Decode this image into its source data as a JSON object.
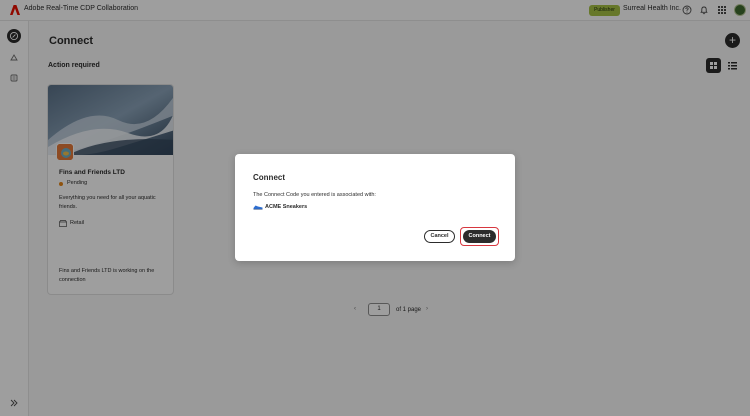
{
  "app": {
    "title": "Adobe Real-Time CDP Collaboration",
    "role_badge": "Publisher",
    "org_name": "Surreal Health Inc.",
    "brand_color": "#eb1000"
  },
  "icons": {
    "logo": "adobe-logo-icon",
    "help": "help-icon",
    "notifications": "bell-icon",
    "apps": "apps-grid-icon",
    "rail": [
      "connect-icon",
      "collaborations-icon",
      "audiences-icon"
    ],
    "rail_expand": "chevron-double-right-icon"
  },
  "page": {
    "title": "Connect",
    "add_label": "+",
    "section_title": "Action required"
  },
  "card": {
    "title": "Fins and Friends LTD",
    "status": "Pending",
    "status_color": "#e68619",
    "description": "Everything you need for all your aquatic friends.",
    "industry": "Retail",
    "footer": "Fins and Friends LTD is working on the connection"
  },
  "pagination": {
    "prev": "‹",
    "current_page": "1",
    "of_label": "of 1 page",
    "next": "›"
  },
  "dialog": {
    "title": "Connect",
    "message": "The Connect Code you entered is associated with:",
    "brand_name": "ACME Sneakers",
    "cancel_label": "Cancel",
    "connect_label": "Connect",
    "highlight_color": "#d7373f"
  }
}
